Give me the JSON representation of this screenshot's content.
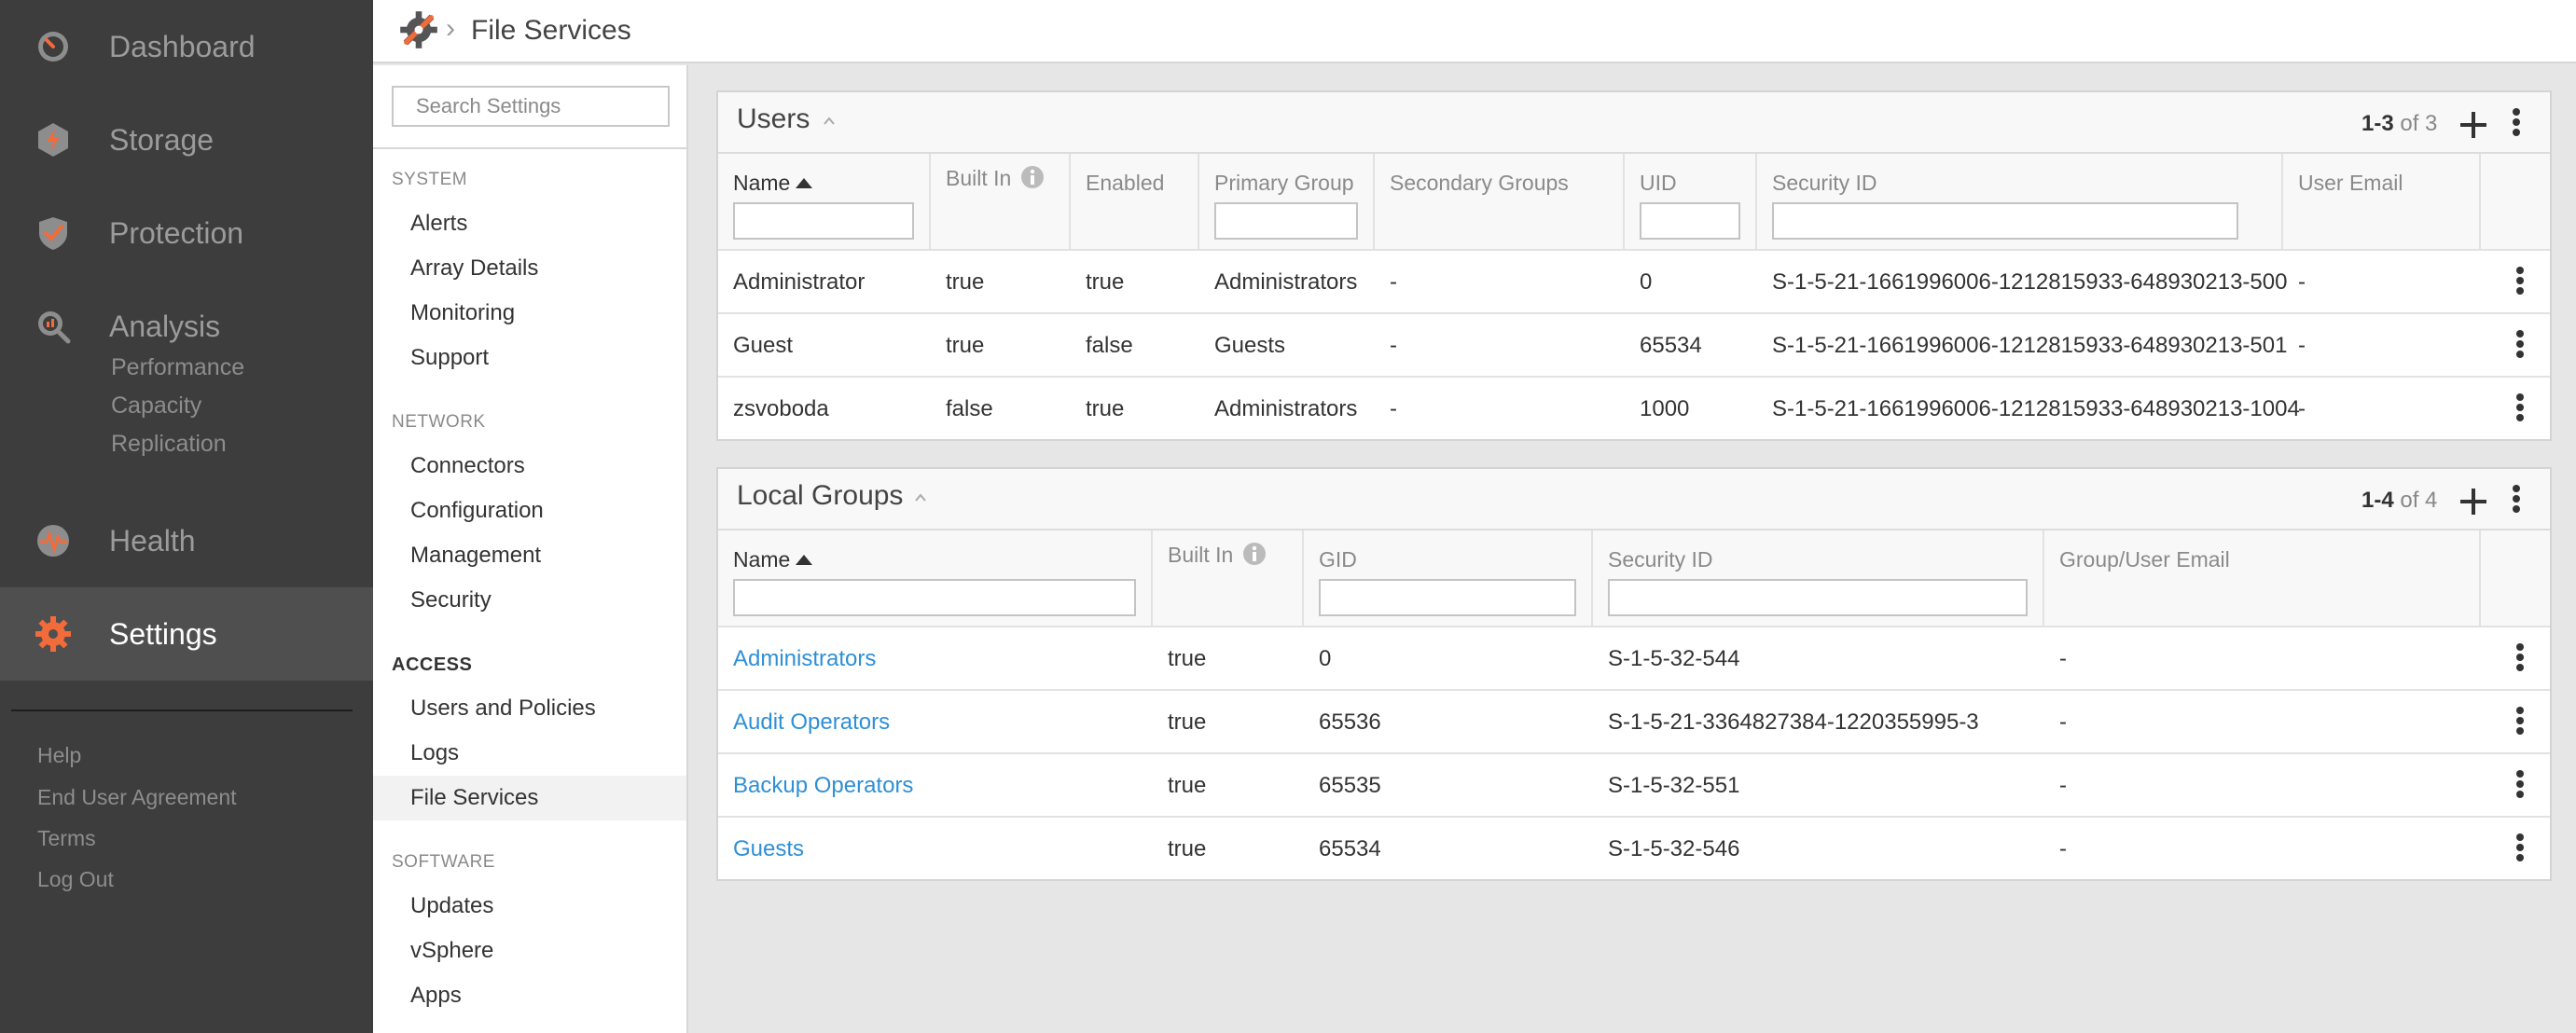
{
  "nav": {
    "items": [
      {
        "label": "Dashboard",
        "icon": "dashboard-gauge-icon"
      },
      {
        "label": "Storage",
        "icon": "storage-bolt-icon"
      },
      {
        "label": "Protection",
        "icon": "protection-shield-icon"
      },
      {
        "label": "Analysis",
        "icon": "analysis-magnifier-icon"
      },
      {
        "label": "Health",
        "icon": "health-pulse-icon"
      },
      {
        "label": "Settings",
        "icon": "settings-gear-icon"
      }
    ],
    "analysis_sub": [
      "Performance",
      "Capacity",
      "Replication"
    ],
    "footer": [
      "Help",
      "End User Agreement",
      "Terms",
      "Log Out"
    ]
  },
  "topbar": {
    "title": "File Services",
    "separator": "›"
  },
  "sidebar": {
    "search_placeholder": "Search Settings",
    "sections": [
      {
        "heading": "SYSTEM",
        "items": [
          "Alerts",
          "Array Details",
          "Monitoring",
          "Support"
        ]
      },
      {
        "heading": "NETWORK",
        "items": [
          "Connectors",
          "Configuration",
          "Management",
          "Security"
        ]
      },
      {
        "heading": "ACCESS",
        "items": [
          "Users and Policies",
          "Logs",
          "File Services"
        ]
      },
      {
        "heading": "SOFTWARE",
        "items": [
          "Updates",
          "vSphere",
          "Apps"
        ]
      }
    ],
    "active_item": "File Services"
  },
  "users": {
    "title": "Users",
    "pager_range": "1-3",
    "pager_total": "of 3",
    "columns": [
      "Name",
      "Built In",
      "Enabled",
      "Primary Group",
      "Secondary Groups",
      "UID",
      "Security ID",
      "User Email"
    ],
    "rows": [
      [
        "Administrator",
        "true",
        "true",
        "Administrators",
        "-",
        "0",
        "S-1-5-21-1661996006-1212815933-648930213-500",
        "-"
      ],
      [
        "Guest",
        "true",
        "false",
        "Guests",
        "-",
        "65534",
        "S-1-5-21-1661996006-1212815933-648930213-501",
        "-"
      ],
      [
        "zsvoboda",
        "false",
        "true",
        "Administrators",
        "-",
        "1000",
        "S-1-5-21-1661996006-1212815933-648930213-1004",
        "-"
      ]
    ]
  },
  "groups": {
    "title": "Local Groups",
    "pager_range": "1-4",
    "pager_total": "of 4",
    "columns": [
      "Name",
      "Built In",
      "GID",
      "Security ID",
      "Group/User Email"
    ],
    "rows": [
      [
        "Administrators",
        "true",
        "0",
        "S-1-5-32-544",
        "-"
      ],
      [
        "Audit Operators",
        "true",
        "65536",
        "S-1-5-21-3364827384-1220355995-3",
        "-"
      ],
      [
        "Backup Operators",
        "true",
        "65535",
        "S-1-5-32-551",
        "-"
      ],
      [
        "Guests",
        "true",
        "65534",
        "S-1-5-32-546",
        "-"
      ]
    ]
  },
  "colors": {
    "accent": "#f26b3a",
    "link": "#2e8fd6",
    "nav_bg": "#3d3d3d"
  }
}
